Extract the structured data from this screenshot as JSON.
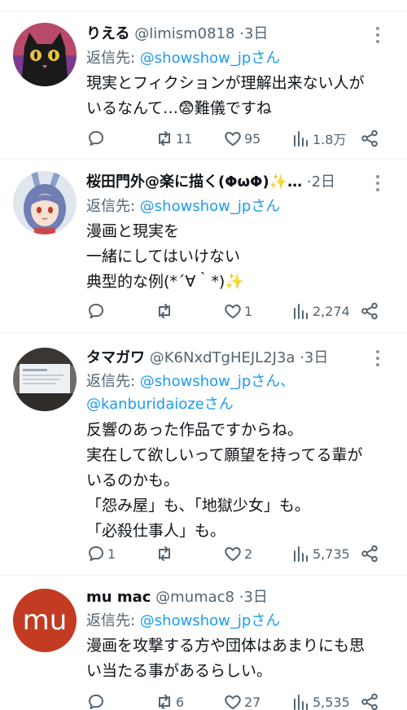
{
  "tweets": [
    {
      "name": "りえる",
      "handle": "@limism0818",
      "separator": "·",
      "time": "3日",
      "reply_prefix": "返信先: ",
      "reply_line1": "@showshow_jpさん",
      "reply_line2": "",
      "text": "現実とフィクションが理解出来ない人が\nいるなんて…😨難儀ですね",
      "replies": "",
      "retweets": "11",
      "likes": "95",
      "views": "1.8万",
      "avatar": "black-cat-painting-icon"
    },
    {
      "name": "桜田門外@楽に描く(ΦωΦ)✨…",
      "handle": "",
      "separator": "·",
      "time": "2日",
      "reply_prefix": "返信先: ",
      "reply_line1": "@showshow_jpさん",
      "reply_line2": "",
      "text": "漫画と現実を\n一緒にしてはいけない\n典型的な例(*´∀｀*)✨",
      "replies": "",
      "retweets": "",
      "likes": "1",
      "views": "2,274",
      "avatar": "anime-girl-bunny-ears-icon"
    },
    {
      "name": "タマガワ",
      "handle": "@K6NxdTgHEJL2J3a",
      "separator": "·",
      "time": "3日",
      "reply_prefix": "返信先: ",
      "reply_line1": "@showshow_jpさん、",
      "reply_line2": "@kanburidaiozeさん",
      "text": "反響のあった作品ですからね。\n実在して欲しいって願望を持ってる輩が\nいるのかも。\n「怨み屋」も、「地獄少女」も。\n「必殺仕事人」も。",
      "replies": "1",
      "retweets": "",
      "likes": "2",
      "views": "5,735",
      "avatar": "laptop-screen-photo-icon"
    },
    {
      "name": "mu mac",
      "handle": "@mumac8",
      "separator": "·",
      "time": "3日",
      "reply_prefix": "返信先: ",
      "reply_line1": "@showshow_jpさん",
      "reply_line2": "",
      "text": "漫画を攻撃する方や団体はあまりにも思\nい当たる事があるらしい。",
      "replies": "",
      "retweets": "6",
      "likes": "27",
      "views": "5,535",
      "avatar_text": "mu",
      "avatar_color": "#c23b22"
    }
  ],
  "colors": {
    "text": "#0f1419",
    "secondary": "#536471",
    "link": "#1d9bf0",
    "divider": "#eff3f4"
  }
}
